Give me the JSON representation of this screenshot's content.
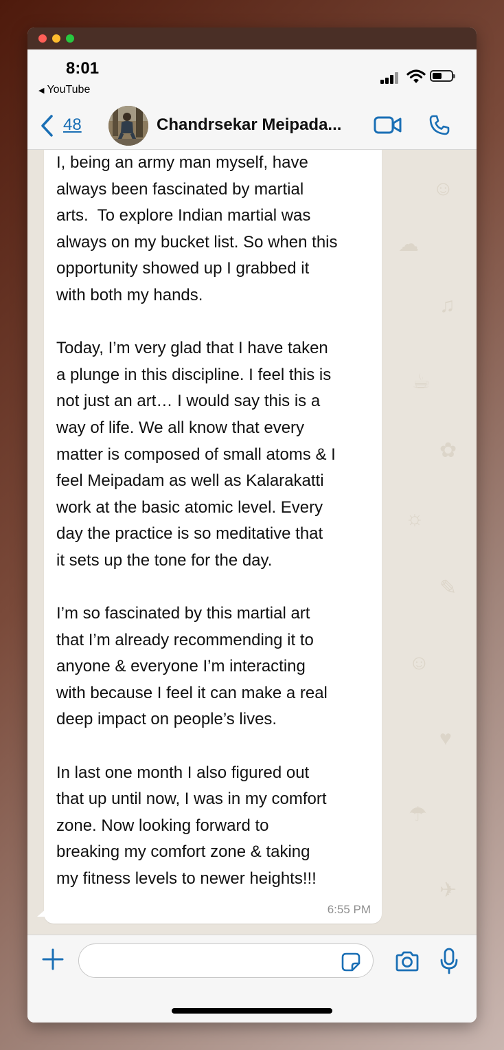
{
  "status_bar": {
    "time": "8:01",
    "back_app": "YouTube",
    "back_app_icon": "left-triangle-icon",
    "signal_icon": "cellular-signal-icon",
    "wifi_icon": "wifi-icon",
    "battery_icon": "battery-icon",
    "battery_level": 0.5
  },
  "chat_header": {
    "back_icon": "chevron-left-icon",
    "unread_count": "48",
    "contact_name": "Chandrsekar Meipada...",
    "video_icon": "video-camera-icon",
    "phone_icon": "phone-icon",
    "accent_color": "#1a6fb5"
  },
  "message": {
    "text": "I, being an army man myself, have\nalways been fascinated by martial\narts.  To explore Indian martial was\nalways on my bucket list. So when this\nopportunity showed up I grabbed it\nwith both my hands.\n\nToday, I’m very glad that I have taken\na plunge in this discipline. I feel this is\nnot just an art… I would say this is a\nway of life. We all know that every\nmatter is composed of small atoms & I\nfeel Meipadam as well as Kalarakatti\nwork at the basic atomic level. Every\nday the practice is so meditative that\nit sets up the tone for the day.\n\nI’m so fascinated by this martial art\nthat I’m already recommending it to\nanyone & everyone I’m interacting\nwith because I feel it can make a real\ndeep impact on people’s lives.\n\nIn last one month I also figured out\nthat up until now, I was in my comfort\nzone. Now looking forward to\nbreaking my comfort zone & taking\nmy fitness levels to newer heights!!!",
    "time": "6:55 PM"
  },
  "input_bar": {
    "plus_icon": "plus-icon",
    "message_value": "",
    "sticker_icon": "sticker-icon",
    "camera_icon": "camera-icon",
    "mic_icon": "microphone-icon"
  }
}
